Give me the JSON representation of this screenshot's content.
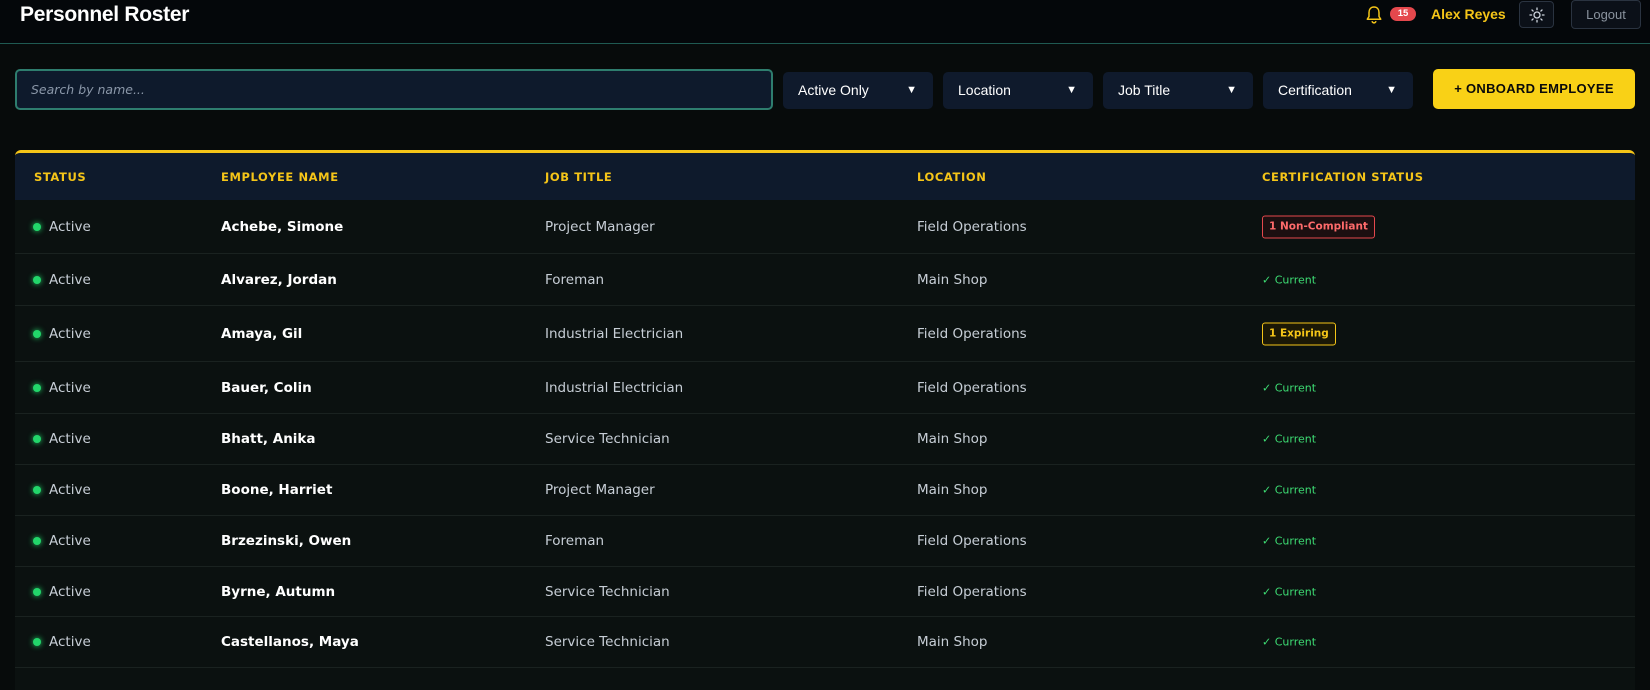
{
  "header": {
    "title": "Personnel Roster",
    "notification_count": "15",
    "user_name": "Alex Reyes",
    "logout_label": "Logout",
    "icons": {
      "bell": "bell-icon",
      "theme": "sun-icon"
    }
  },
  "toolbar": {
    "search_placeholder": "Search by name...",
    "search_value": "",
    "filters": [
      {
        "label": "Active Only"
      },
      {
        "label": "Location"
      },
      {
        "label": "Job Title"
      },
      {
        "label": "Certification"
      }
    ],
    "onboard_label": "+ ONBOARD EMPLOYEE"
  },
  "table": {
    "columns": [
      "STATUS",
      "EMPLOYEE NAME",
      "JOB TITLE",
      "LOCATION",
      "CERTIFICATION STATUS"
    ],
    "rows": [
      {
        "status": "Active",
        "name": "Achebe, Simone",
        "job": "Project Manager",
        "location": "Field Operations",
        "cert": "1 Non-Compliant",
        "cert_type": "bad"
      },
      {
        "status": "Active",
        "name": "Alvarez, Jordan",
        "job": "Foreman",
        "location": "Main Shop",
        "cert": "✓ Current",
        "cert_type": "current"
      },
      {
        "status": "Active",
        "name": "Amaya, Gil",
        "job": "Industrial Electrician",
        "location": "Field Operations",
        "cert": "1 Expiring",
        "cert_type": "warn"
      },
      {
        "status": "Active",
        "name": "Bauer, Colin",
        "job": "Industrial Electrician",
        "location": "Field Operations",
        "cert": "✓ Current",
        "cert_type": "current"
      },
      {
        "status": "Active",
        "name": "Bhatt, Anika",
        "job": "Service Technician",
        "location": "Main Shop",
        "cert": "✓ Current",
        "cert_type": "current"
      },
      {
        "status": "Active",
        "name": "Boone, Harriet",
        "job": "Project Manager",
        "location": "Main Shop",
        "cert": "✓ Current",
        "cert_type": "current"
      },
      {
        "status": "Active",
        "name": "Brzezinski, Owen",
        "job": "Foreman",
        "location": "Field Operations",
        "cert": "✓ Current",
        "cert_type": "current"
      },
      {
        "status": "Active",
        "name": "Byrne, Autumn",
        "job": "Service Technician",
        "location": "Field Operations",
        "cert": "✓ Current",
        "cert_type": "current"
      },
      {
        "status": "Active",
        "name": "Castellanos, Maya",
        "job": "Service Technician",
        "location": "Main Shop",
        "cert": "✓ Current",
        "cert_type": "current"
      }
    ]
  },
  "colors": {
    "accent": "#f5c518",
    "status_active": "#22d66a",
    "noncompliant": "#e5484d"
  }
}
